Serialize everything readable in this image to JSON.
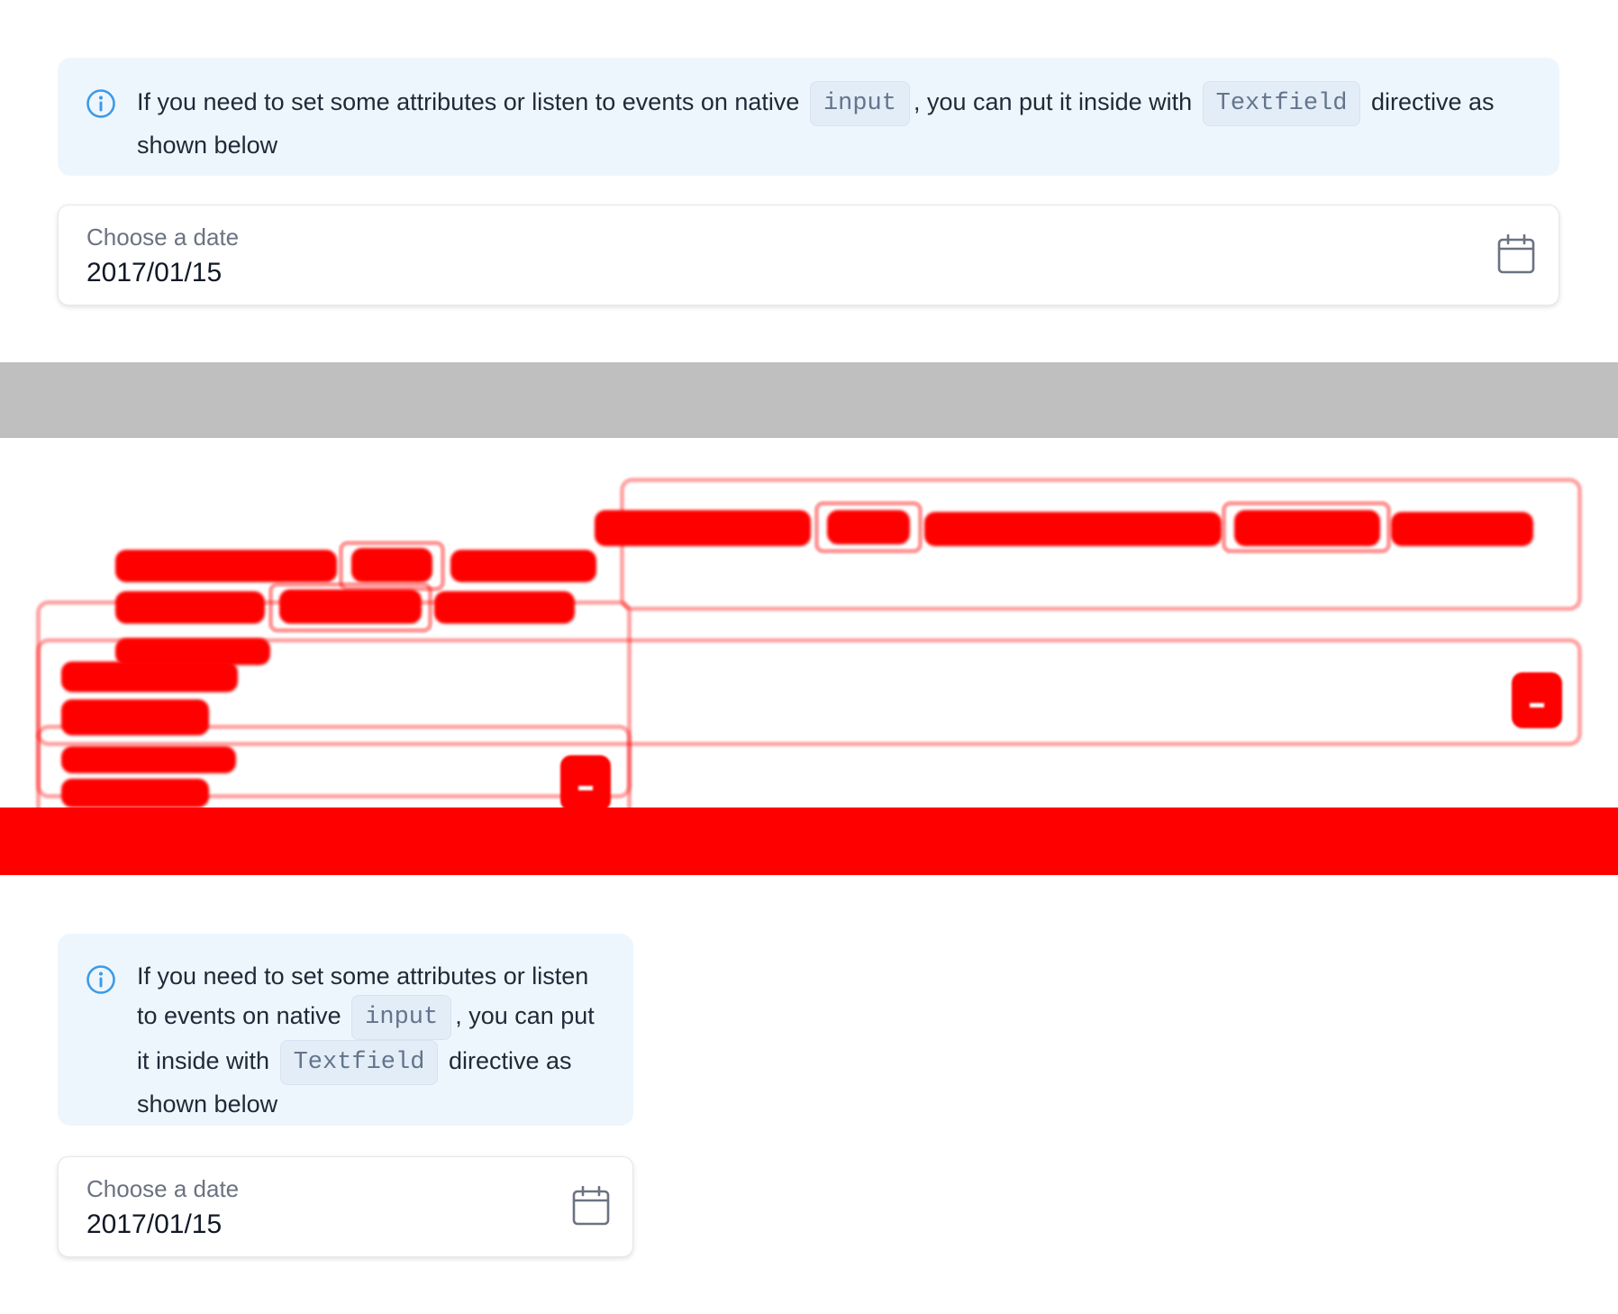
{
  "top_section": {
    "callout": {
      "icon": "info-icon",
      "text_before": "If you need to set some attributes or listen to events on native",
      "code_1": "input",
      "text_middle": ", you can put it inside with",
      "code_2": "Textfield",
      "text_after": "directive as shown below"
    },
    "date_field": {
      "label": "Choose a date",
      "value": "2017/01/15",
      "icon": "calendar-icon"
    }
  },
  "bottom_section": {
    "callout": {
      "icon": "info-icon",
      "text_before": "If you need to set some attributes or listen to events on native",
      "code_1": "input",
      "text_middle": ", you can put it inside with",
      "code_2": "Textfield",
      "text_after": "directive as shown below"
    },
    "date_field": {
      "label": "Choose a date",
      "value": "2017/01/15",
      "icon": "calendar-icon"
    }
  },
  "colors": {
    "callout_bg": "#eef6fd",
    "info_icon": "#3b9ae8",
    "diff_highlight": "#ff0000",
    "separator_gray": "#bfbfbf"
  }
}
